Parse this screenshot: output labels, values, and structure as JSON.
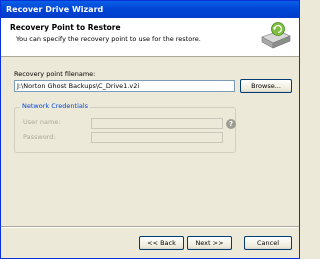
{
  "window": {
    "title": "Recover Drive Wizard"
  },
  "header": {
    "title": "Recovery Point to Restore",
    "subtitle": "You can specify the recovery point to use for the restore.",
    "icon": "drive-restore-icon"
  },
  "recovery_point": {
    "label": "Recovery point filename:",
    "value": "J:\\Norton Ghost Backups\\C_Drive1.v2i",
    "browse_label": "Browse..."
  },
  "credentials": {
    "group_label": "Network Credentials",
    "username_label": "User name:",
    "username_value": "",
    "password_label": "Password:",
    "password_value": "",
    "help_icon": "question-icon"
  },
  "footer": {
    "back_label": "<< Back",
    "next_label": "Next >>",
    "cancel_label": "Cancel"
  }
}
